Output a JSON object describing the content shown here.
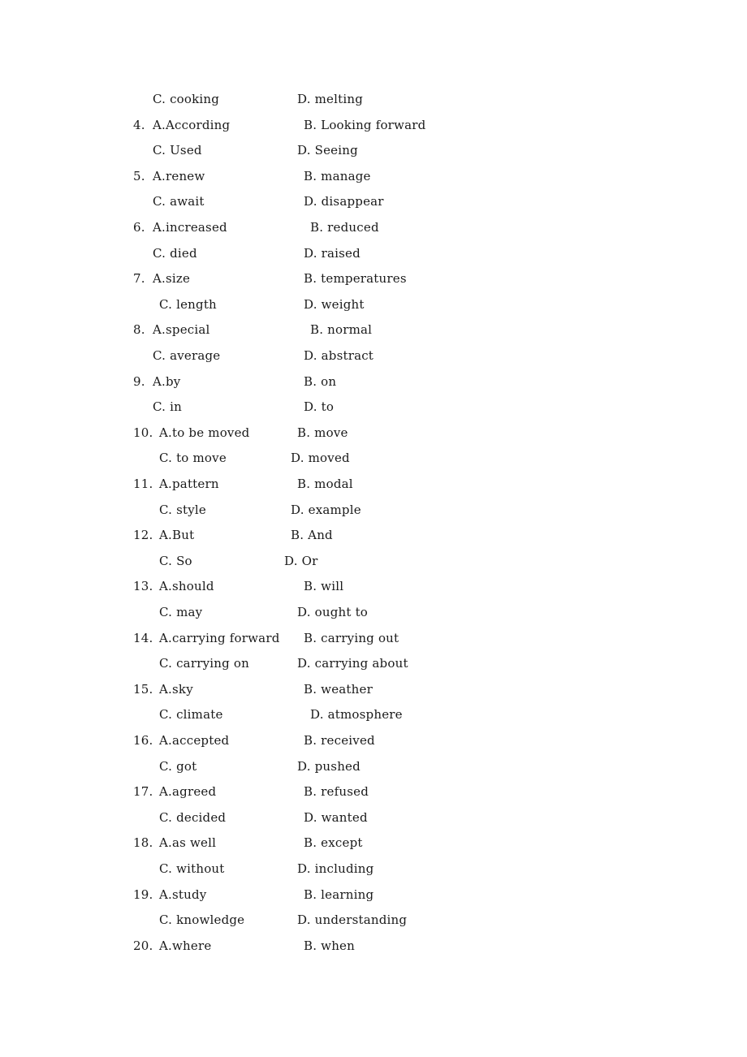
{
  "document": {
    "lines": [
      {
        "num": "",
        "a": "C. cooking",
        "b": "D. melting"
      },
      {
        "num": "4.",
        "a": "A.According",
        "b": "B. Looking forward"
      },
      {
        "num": "",
        "a": "C. Used",
        "b": "D. Seeing"
      },
      {
        "num": "5.",
        "a": "A.renew",
        "b": "B. manage"
      },
      {
        "num": "",
        "a": "C. await",
        "b": "D. disappear"
      },
      {
        "num": "6.",
        "a": "A.increased",
        "b": "B. reduced"
      },
      {
        "num": "",
        "a": "C. died",
        "b": "D. raised"
      },
      {
        "num": "7.",
        "a": "A.size",
        "b": "B. temperatures"
      },
      {
        "num": "",
        "a": "C. length",
        "b": "D. weight"
      },
      {
        "num": "8.",
        "a": "A.special",
        "b": "B. normal"
      },
      {
        "num": "",
        "a": "C. average",
        "b": "D. abstract"
      },
      {
        "num": "9.",
        "a": "A.by",
        "b": "B. on"
      },
      {
        "num": "",
        "a": "C. in",
        "b": "D. to"
      },
      {
        "num": "10.",
        "a": "A.to be moved",
        "b": "B. move"
      },
      {
        "num": "",
        "a": "C. to move",
        "b": "D. moved"
      },
      {
        "num": "11.",
        "a": "A.pattern",
        "b": "B. modal"
      },
      {
        "num": "",
        "a": "C. style",
        "b": "D. example"
      },
      {
        "num": "12.",
        "a": "A.But",
        "b": "B. And"
      },
      {
        "num": "",
        "a": "C. So",
        "b": "D. Or"
      },
      {
        "num": "13.",
        "a": "A.should",
        "b": "B. will"
      },
      {
        "num": "",
        "a": "C. may",
        "b": "D. ought to"
      },
      {
        "num": "14.",
        "a": "A.carrying forward",
        "b": "B. carrying out"
      },
      {
        "num": "",
        "a": "C. carrying on",
        "b": "D. carrying about"
      },
      {
        "num": "15.",
        "a": "A.sky",
        "b": "B. weather"
      },
      {
        "num": "",
        "a": "C. climate",
        "b": "D. atmosphere"
      },
      {
        "num": "16.",
        "a": "A.accepted",
        "b": "B. received"
      },
      {
        "num": "",
        "a": "C. got",
        "b": "D. pushed"
      },
      {
        "num": "17.",
        "a": "A.agreed",
        "b": "B. refused"
      },
      {
        "num": "",
        "a": "C. decided",
        "b": "D. wanted"
      },
      {
        "num": "18.",
        "a": "A.as well",
        "b": "B. except"
      },
      {
        "num": "",
        "a": "C. without",
        "b": "D. including"
      },
      {
        "num": "19.",
        "a": "A.study",
        "b": "B. learning"
      },
      {
        "num": "",
        "a": "C. knowledge",
        "b": "D. understanding"
      },
      {
        "num": "20.",
        "a": "A.where",
        "b": "B. when"
      }
    ]
  }
}
